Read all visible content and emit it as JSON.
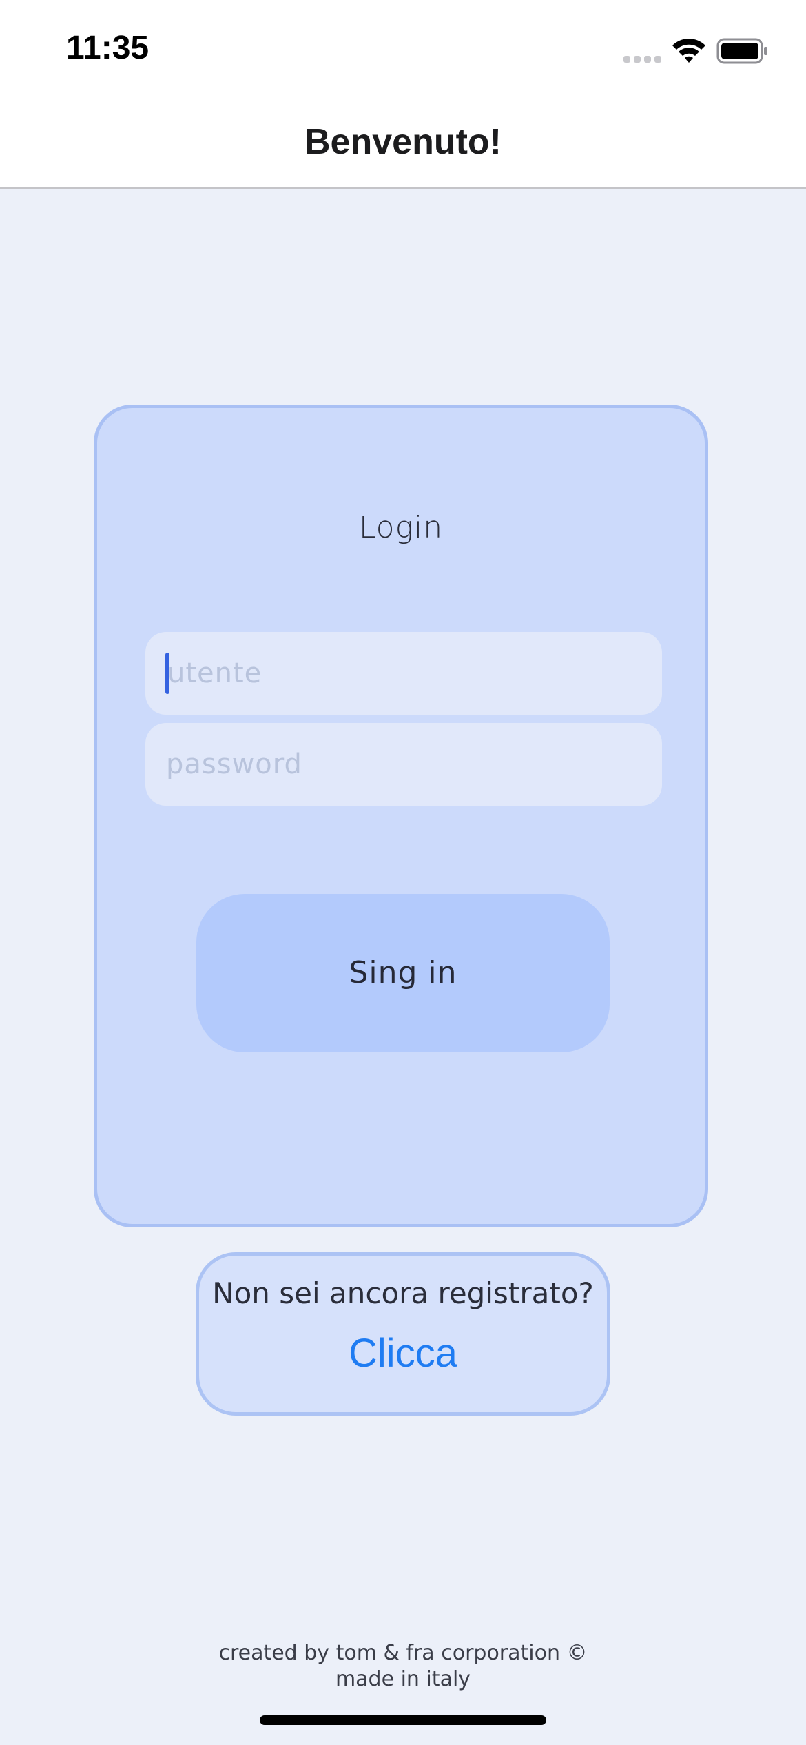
{
  "status_bar": {
    "time": "11:35",
    "icons": [
      "cellular-signal-icon",
      "wifi-icon",
      "battery-icon"
    ]
  },
  "nav": {
    "title": "Benvenuto!"
  },
  "login": {
    "title": "Login",
    "username_placeholder": "utente",
    "password_placeholder": "password",
    "signin_label": "Sing in"
  },
  "register": {
    "question": "Non sei ancora registrato?",
    "link_label": "Clicca"
  },
  "footer": {
    "line1": "created by tom & fra corporation ©",
    "line2": "made in italy"
  },
  "colors": {
    "background": "#ecf0f9",
    "card": "#ccdafb",
    "card_border": "#a9c0f4",
    "field": "#e1e8fa",
    "button": "#b3cafc",
    "link": "#1f7cf2",
    "caret": "#3462e0"
  }
}
